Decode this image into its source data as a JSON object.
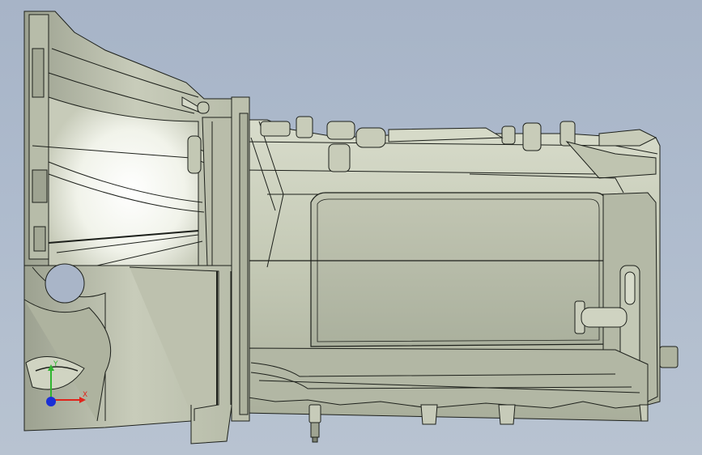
{
  "viewport": {
    "background_top": "#a7b4c7",
    "background_bottom": "#b8c3d1"
  },
  "model": {
    "body_color": "#c9cdbb",
    "shade_color": "#9ea391",
    "dark_color": "#6f7466",
    "edge_color": "#1d201b",
    "highlight_color": "#e9ecdf"
  },
  "triad": {
    "x_label": "X",
    "y_label": "Y",
    "x_color": "#e0241b",
    "y_color": "#2fb52f",
    "z_color": "#1a2fd6"
  }
}
